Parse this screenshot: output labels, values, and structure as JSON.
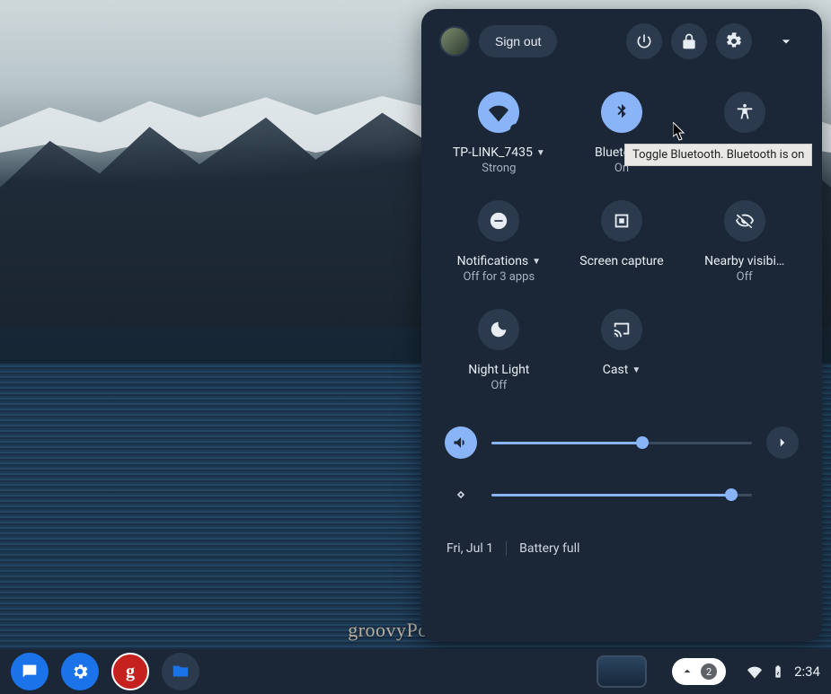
{
  "header": {
    "signout": "Sign out"
  },
  "tiles": {
    "wifi": {
      "label": "TP-LINK_7435",
      "sub": "Strong",
      "has_caret": true,
      "active": true
    },
    "bluetooth": {
      "label": "Bluetooth",
      "sub": "On",
      "has_caret": false,
      "active": true
    },
    "accessibility": {
      "label": "Accessibility",
      "sub": "",
      "has_caret": false,
      "active": false
    },
    "notifications": {
      "label": "Notifications",
      "sub": "Off for 3 apps",
      "has_caret": true,
      "active": false
    },
    "screencap": {
      "label": "Screen capture",
      "sub": "",
      "has_caret": false,
      "active": false
    },
    "nearby": {
      "label": "Nearby visibi…",
      "sub": "Off",
      "has_caret": false,
      "active": false
    },
    "nightlight": {
      "label": "Night Light",
      "sub": "Off",
      "has_caret": false,
      "active": false
    },
    "cast": {
      "label": "Cast",
      "sub": "",
      "has_caret": true,
      "active": false
    }
  },
  "tooltip": "Toggle Bluetooth. Bluetooth is on",
  "sliders": {
    "volume_pct": 58,
    "brightness_pct": 92
  },
  "footer": {
    "date": "Fri, Jul 1",
    "battery": "Battery full"
  },
  "taskbar": {
    "notif_count": "2",
    "time": "2:34"
  },
  "watermark": "groovyPost.com"
}
